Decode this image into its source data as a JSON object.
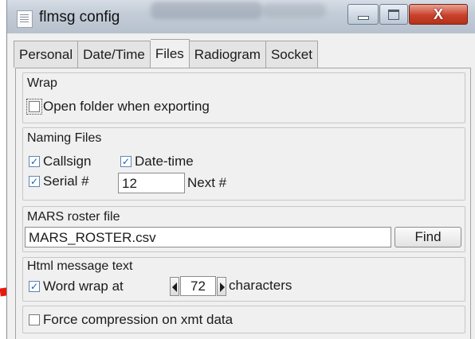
{
  "window": {
    "title": "flmsg config"
  },
  "tabs": [
    {
      "label": "Personal"
    },
    {
      "label": "Date/Time"
    },
    {
      "label": "Files",
      "active": true
    },
    {
      "label": "Radiogram"
    },
    {
      "label": "Socket"
    }
  ],
  "wrap": {
    "group_label": "Wrap",
    "open_folder": {
      "label": "Open folder when exporting",
      "checked": false
    }
  },
  "naming": {
    "group_label": "Naming Files",
    "callsign": {
      "label": "Callsign",
      "checked": true
    },
    "datetime": {
      "label": "Date-time",
      "checked": true
    },
    "serial": {
      "label": "Serial #",
      "checked": true
    },
    "next_value": "12",
    "next_label": "Next #"
  },
  "mars": {
    "group_label": "MARS roster file",
    "file_value": "MARS_ROSTER.csv",
    "find_label": "Find"
  },
  "html": {
    "group_label": "Html message text",
    "word_wrap": {
      "label": "Word wrap at",
      "checked": true
    },
    "wrap_value": "72",
    "units_label": "characters"
  },
  "compression": {
    "force": {
      "label": "Force compression on xmt data",
      "checked": false
    }
  },
  "icons": {
    "check_glyph": "✓",
    "close_glyph": "X"
  },
  "colors": {
    "annotation_arrow": "#e8190c",
    "close_button": "#c8412b",
    "check_mark": "#1f5fb0"
  }
}
